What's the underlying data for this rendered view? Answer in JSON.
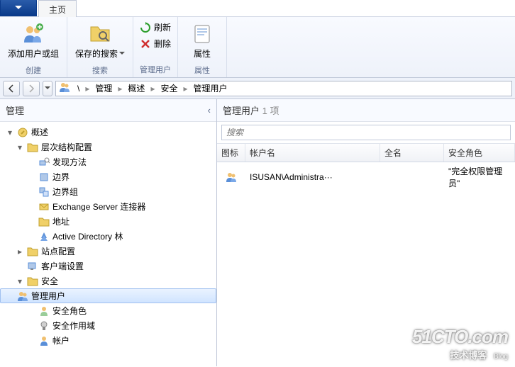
{
  "tab": {
    "main": "主页"
  },
  "ribbon": {
    "create": {
      "add_user_or_group": "添加用户或组",
      "label": "创建"
    },
    "search": {
      "saved_searches": "保存的搜索",
      "label": "搜索"
    },
    "manage_user": {
      "refresh": "刷新",
      "delete": "删除",
      "label": "管理用户"
    },
    "properties": {
      "properties_btn": "属性",
      "label": "属性"
    }
  },
  "breadcrumb": {
    "items": [
      "管理",
      "概述",
      "安全",
      "管理用户"
    ]
  },
  "left": {
    "header": "管理",
    "tree": {
      "overview": "概述",
      "hierarchy": "层次结构配置",
      "discovery": "发现方法",
      "boundary": "边界",
      "boundary_group": "边界组",
      "exchange": "Exchange Server 连接器",
      "address": "地址",
      "ad_forest": "Active Directory 林",
      "site_config": "站点配置",
      "client_settings": "客户端设置",
      "security": "安全",
      "manage_user": "管理用户",
      "security_role": "安全角色",
      "security_scope": "安全作用域",
      "accounts": "帐户"
    }
  },
  "right": {
    "header_prefix": "管理用户",
    "header_count": "1 项",
    "search_placeholder": "搜索",
    "columns": {
      "icon": "图标",
      "account": "帐户名",
      "fullname": "全名",
      "role": "安全角色"
    },
    "rows": [
      {
        "account": "ISUSAN\\Administra···",
        "fullname": "",
        "role": "\"完全权限管理员\""
      }
    ]
  },
  "watermark": {
    "line1": "51CTO.com",
    "line2": "技术博客",
    "line2_small": "Blog"
  }
}
